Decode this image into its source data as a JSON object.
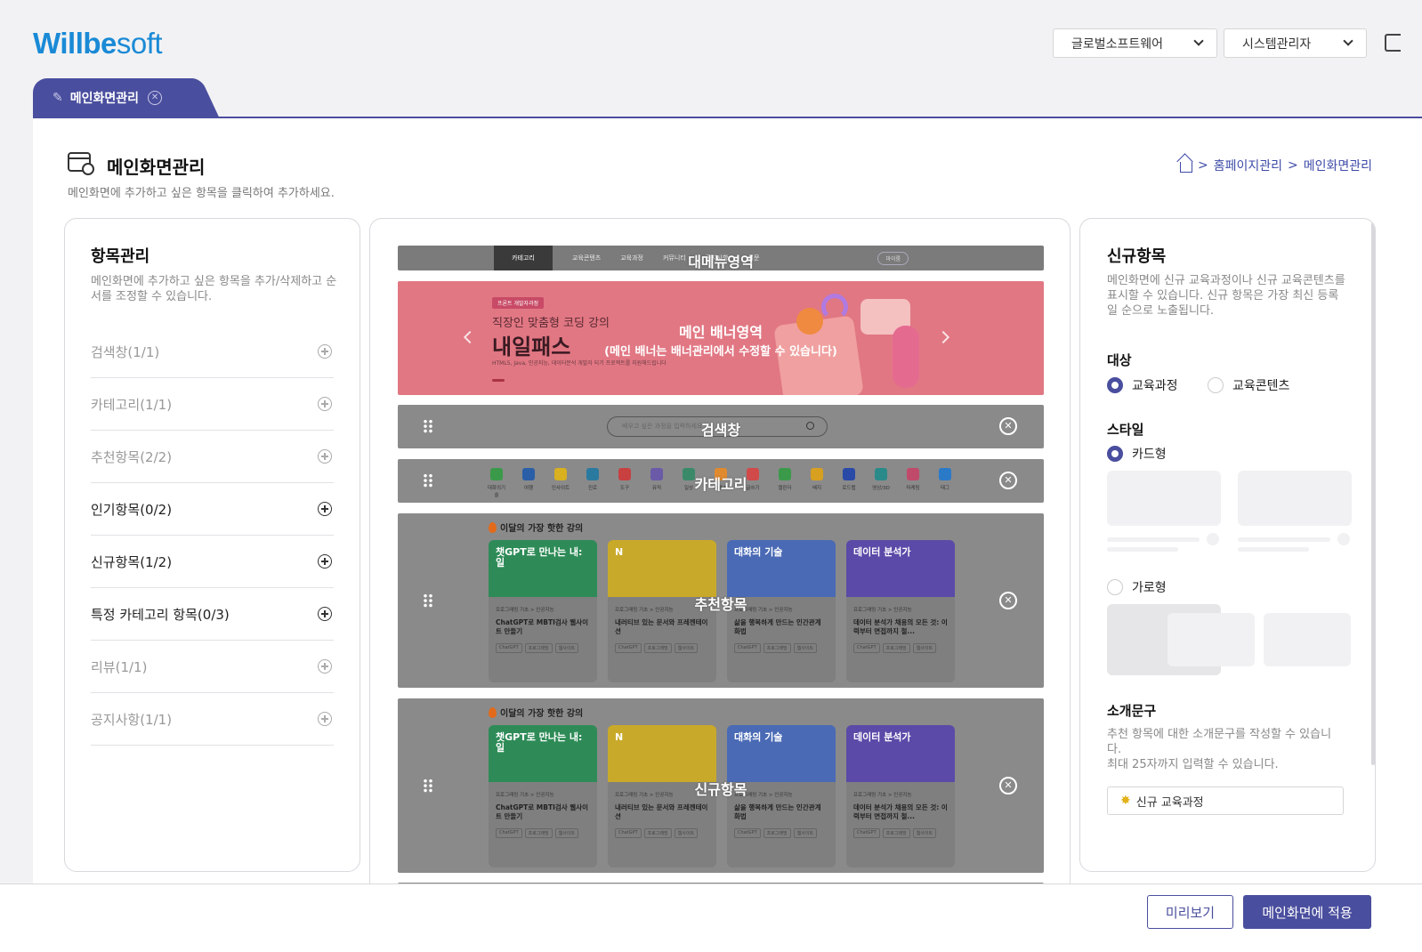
{
  "header": {
    "logo_bold": "Willbe",
    "logo_light": "soft",
    "company_select": "글로벌소프트웨어",
    "user_select": "시스템관리자"
  },
  "tabs": [
    {
      "label": "메인화면관리",
      "active": true
    }
  ],
  "page": {
    "title": "메인화면관리",
    "description": "메인화면에 추가하고 싶은 항목을 클릭하여 추가하세요.",
    "breadcrumb": [
      "홈페이지관리",
      "메인화면관리"
    ],
    "breadcrumb_sep": ">"
  },
  "left_panel": {
    "title": "항목관리",
    "description": "메인화면에 추가하고 싶은 항목을 추가/삭제하고 순서를 조정할 수 있습니다.",
    "items": [
      {
        "label": "검색창(1/1)",
        "enabled": false
      },
      {
        "label": "카테고리(1/1)",
        "enabled": false
      },
      {
        "label": "추천항목(2/2)",
        "enabled": false
      },
      {
        "label": "인기항목(0/2)",
        "enabled": true
      },
      {
        "label": "신규항목(1/2)",
        "enabled": true
      },
      {
        "label": "특정 카테고리 항목(0/3)",
        "enabled": true
      },
      {
        "label": "리뷰(1/1)",
        "enabled": false
      },
      {
        "label": "공지사항(1/1)",
        "enabled": false
      }
    ]
  },
  "preview": {
    "menu_area_label": "대메뉴영역",
    "menu_items": [
      "카테고리",
      "교육콘텐츠",
      "교육과정",
      "커뮤니티",
      "공지사항",
      "설문"
    ],
    "menu_pill": "마이룸",
    "banner_label": "메인 배너영역",
    "banner_note": "(메인 배너는 배너관리에서 수정할 수 있습니다)",
    "banner_tag": "프론트 개발자과정",
    "banner_sub": "직장인 맞춤형 코딩 강의",
    "banner_big": "내일패스",
    "banner_tiny": "HTML5, Java, 인공지능, 데이터분석 개발자 되기 프로젝트를 지원해드립니다",
    "search_label": "검색창",
    "search_placeholder": "배우고 싶은 과정을 입력하세요",
    "category_label": "카테고리",
    "categories": [
      "대화의기술",
      "여행",
      "인사이트",
      "진로",
      "도구",
      "뮤직",
      "일상",
      "스포츠",
      "글쓰기",
      "캘린더",
      "배지",
      "로드맵",
      "영상/3D",
      "마케팅",
      "태그"
    ],
    "recommend_label": "추천항목",
    "new_label": "신규항목",
    "cards_heading": "이달의 가장 핫한 강의",
    "cards": [
      {
        "img_text": "챗GPT로 만나는 내:일",
        "meta": "프로그래밍 기초 > 인공지능",
        "title": "ChatGPT로 MBTI검사 웹사이트 만들기",
        "chips": [
          "ChatGPT",
          "프로그래밍",
          "웹사이트"
        ],
        "color": "#2e8b57"
      },
      {
        "img_text": "N",
        "meta": "프로그래밍 기초 > 인공지능",
        "title": "내러티브 있는 문서와 프레젠테이션",
        "chips": [
          "ChatGPT",
          "프로그래밍",
          "웹사이트"
        ],
        "color": "#c9a92a"
      },
      {
        "img_text": "대화의 기술",
        "meta": "프로그래밍 기초 > 인공지능",
        "title": "삶을 행복하게 만드는 인간관계 화법",
        "chips": [
          "ChatGPT",
          "프로그래밍",
          "웹사이트"
        ],
        "color": "#4a6ab5"
      },
      {
        "img_text": "데이터 분석가",
        "meta": "프로그래밍 기초 > 인공지능",
        "title": "데이터 분석가 채용의 모든 것: 이력부터 면접까지 철...",
        "chips": [
          "ChatGPT",
          "프로그래밍",
          "웹사이트"
        ],
        "color": "#5b4aa8"
      }
    ]
  },
  "right_panel": {
    "title": "신규항목",
    "description": "메인화면에 신규 교육과정이나 신규 교육콘텐츠를 표시할 수 있습니다. 신규 항목은 가장 최신 등록일 순으로 노출됩니다.",
    "target_label": "대상",
    "target_options": [
      {
        "label": "교육과정",
        "selected": true
      },
      {
        "label": "교육콘텐츠",
        "selected": false
      }
    ],
    "style_label": "스타일",
    "style_options": [
      {
        "label": "카드형",
        "selected": true
      },
      {
        "label": "가로형",
        "selected": false
      }
    ],
    "intro_label": "소개문구",
    "intro_desc_1": "추천 항목에 대한 소개문구를 작성할 수 있습니다.",
    "intro_desc_2": "최대 25자까지 입력할 수 있습니다.",
    "intro_value": "신규 교육과정"
  },
  "actions": {
    "preview": "미리보기",
    "apply": "메인화면에 적용"
  },
  "colors": {
    "primary": "#4a4e9e",
    "brand": "#1a8ad6"
  }
}
